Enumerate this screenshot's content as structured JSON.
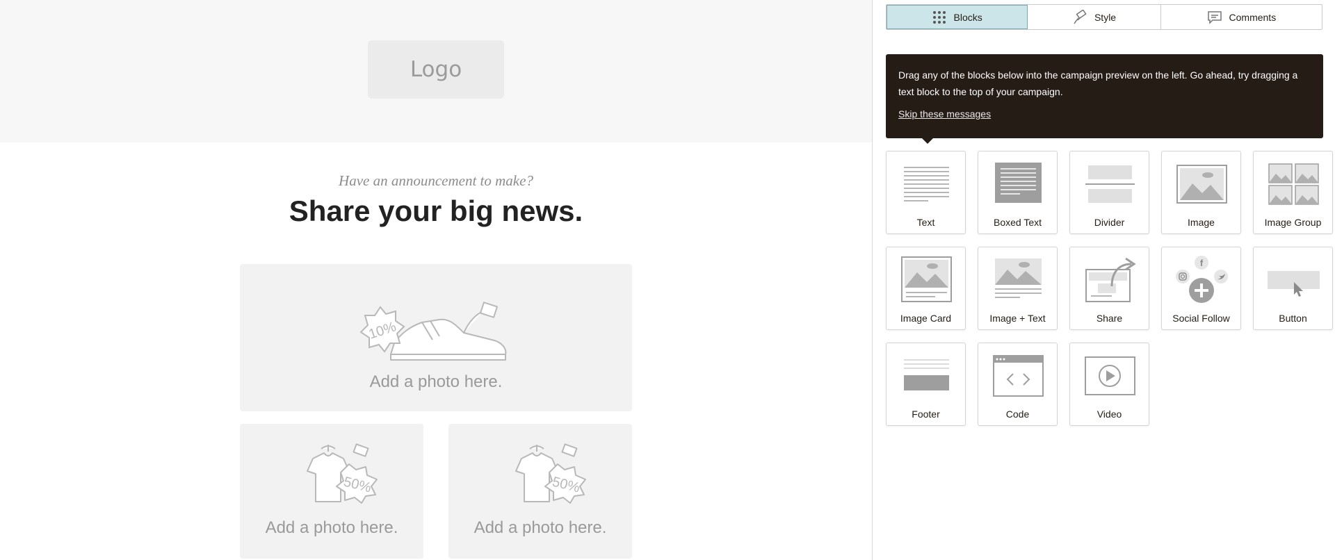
{
  "preview": {
    "logo": "Logo",
    "kicker": "Have an announcement to make?",
    "headline": "Share your big news.",
    "photo_main_label": "Add a photo here.",
    "photo_left_label": "Add a photo here.",
    "photo_right_label": "Add a photo here.",
    "photo_main_badge": "10%",
    "photo_small_badge": "50%"
  },
  "sidebar": {
    "tabs": [
      {
        "label": "Blocks",
        "icon": "grid-icon",
        "active": true
      },
      {
        "label": "Style",
        "icon": "paint-icon",
        "active": false
      },
      {
        "label": "Comments",
        "icon": "comment-icon",
        "active": false
      }
    ],
    "tip": {
      "text": "Drag any of the blocks below into the campaign preview on the left. Go ahead, try dragging a text block to the top of your campaign.",
      "skip": "Skip these messages"
    },
    "blocks": [
      {
        "label": "Text",
        "icon": "text-block-icon"
      },
      {
        "label": "Boxed Text",
        "icon": "boxed-text-block-icon"
      },
      {
        "label": "Divider",
        "icon": "divider-block-icon"
      },
      {
        "label": "Image",
        "icon": "image-block-icon"
      },
      {
        "label": "Image Group",
        "icon": "image-group-block-icon"
      },
      {
        "label": "Image Card",
        "icon": "image-card-block-icon"
      },
      {
        "label": "Image + Text",
        "icon": "image-text-block-icon"
      },
      {
        "label": "Share",
        "icon": "share-block-icon"
      },
      {
        "label": "Social Follow",
        "icon": "social-follow-block-icon"
      },
      {
        "label": "Button",
        "icon": "button-block-icon"
      },
      {
        "label": "Footer",
        "icon": "footer-block-icon"
      },
      {
        "label": "Code",
        "icon": "code-block-icon"
      },
      {
        "label": "Video",
        "icon": "video-block-icon"
      }
    ]
  },
  "colors": {
    "tab_active_bg": "#cce5e8",
    "tip_bg": "#241c15",
    "icon_gray": "#9e9e9e"
  }
}
